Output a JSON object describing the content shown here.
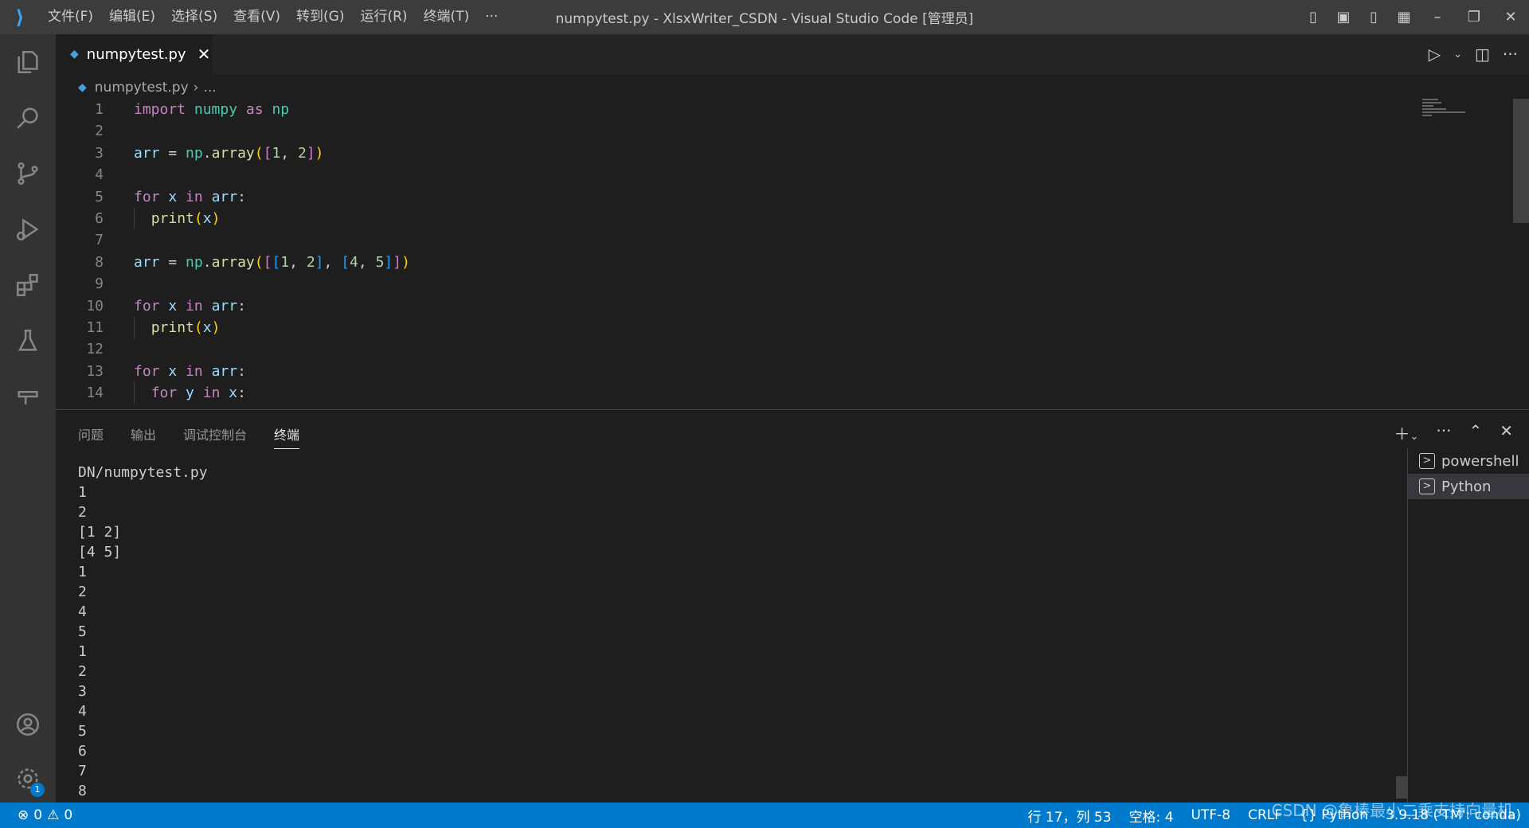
{
  "titlebar": {
    "menus": [
      "文件(F)",
      "编辑(E)",
      "选择(S)",
      "查看(V)",
      "转到(G)",
      "运行(R)",
      "终端(T)",
      "···"
    ],
    "title": "numpytest.py - XlsxWriter_CSDN - Visual Studio Code [管理员]",
    "minimize": "–",
    "restore": "❐",
    "close": "✕"
  },
  "tab": {
    "label": "numpytest.py",
    "close": "✕"
  },
  "breadcrumb": {
    "file": "numpytest.py",
    "sep": "›",
    "rest": "..."
  },
  "editor": {
    "line_numbers": [
      "1",
      "2",
      "3",
      "4",
      "5",
      "6",
      "7",
      "8",
      "9",
      "10",
      "11",
      "12",
      "13",
      "14"
    ]
  },
  "panel": {
    "tabs": [
      "问题",
      "输出",
      "调试控制台",
      "终端"
    ],
    "active_tab": "终端",
    "terminal_lines": [
      "DN/numpytest.py",
      "1",
      "2",
      "[1 2]",
      "[4 5]",
      "1",
      "2",
      "4",
      "5",
      "1",
      "2",
      "3",
      "4",
      "5",
      "6",
      "7",
      "8"
    ],
    "terminals": [
      "powershell",
      "Python"
    ]
  },
  "status": {
    "errors": "0",
    "warnings": "0",
    "position": "行 17，列 53",
    "spaces": "空格: 4",
    "encoding": "UTF-8",
    "eol": "CRLF",
    "language": "Python",
    "interpreter": "3.9.18 ('TM': conda)",
    "watermark": "CSDN @鲁棒最小二乘支持向量机",
    "badge": "1"
  },
  "colors": {
    "statusbar": "#007acc",
    "keyword": "#c586c0",
    "module": "#4ec9b0",
    "variable": "#9cdcfe",
    "function": "#dcdcaa",
    "number": "#b5cea8"
  }
}
